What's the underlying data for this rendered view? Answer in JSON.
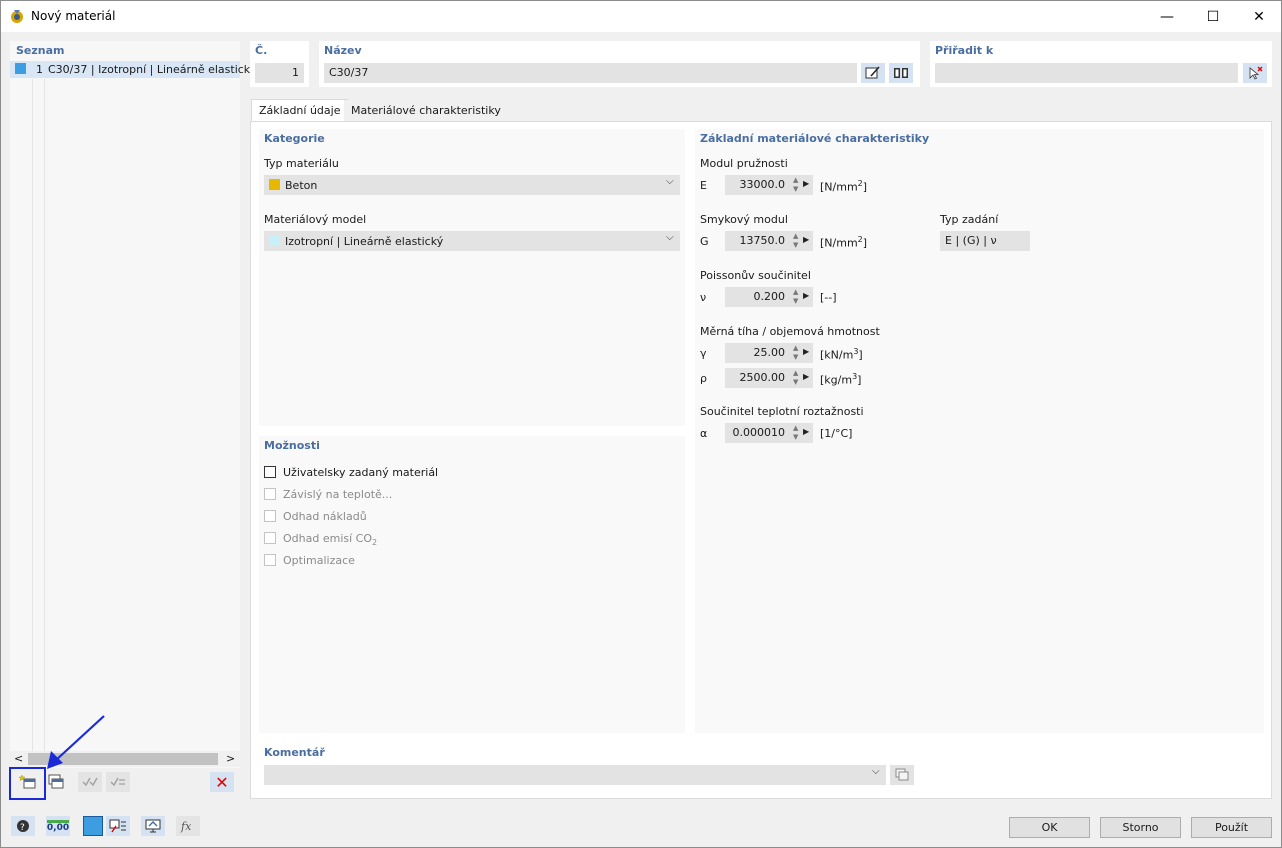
{
  "window": {
    "title": "Nový materiál",
    "minimize_label": "—",
    "maximize_label": "☐",
    "close_label": "✕"
  },
  "left": {
    "title": "Seznam",
    "items": [
      {
        "no": "1",
        "label": "C30/37 | Izotropní | Lineárně elastický"
      }
    ],
    "scroll_left": "<",
    "scroll_right": ">",
    "delete_label": "✕"
  },
  "header": {
    "no_title": "Č.",
    "no_value": "1",
    "name_title": "Název",
    "name_value": "C30/37",
    "assign_title": "Přiřadit k",
    "assign_value": ""
  },
  "tabs": [
    {
      "label": "Základní údaje",
      "active": true
    },
    {
      "label": "Materiálové charakteristiky",
      "active": false
    }
  ],
  "category": {
    "title": "Kategorie",
    "type_label": "Typ materiálu",
    "type_value": "Beton",
    "type_color": "#e6b800",
    "model_label": "Materiálový model",
    "model_value": "Izotropní | Lineárně elastický",
    "model_color": "#c8f0f8",
    "dropdown_arrow": "⌵"
  },
  "options": {
    "title": "Možnosti",
    "items": [
      {
        "label": "Uživatelsky zadaný materiál",
        "checked": false,
        "enabled": true
      },
      {
        "label": "Závislý na teplotě...",
        "checked": false,
        "enabled": false
      },
      {
        "label": "Odhad nákladů",
        "checked": false,
        "enabled": false
      },
      {
        "label": "Odhad emisí CO",
        "sub": "2",
        "checked": false,
        "enabled": false
      },
      {
        "label": "Optimalizace",
        "checked": false,
        "enabled": false
      }
    ]
  },
  "props": {
    "title": "Základní materiálové charakteristiky",
    "modulus_label": "Modul pružnosti",
    "E_sym": "E",
    "E_value": "33000.0",
    "E_unit": "[N/mm",
    "E_unit_sup": "2",
    "E_unit_end": "]",
    "shear_label": "Smykový modul",
    "G_sym": "G",
    "G_value": "13750.0",
    "G_unit": "[N/mm",
    "G_unit_sup": "2",
    "G_unit_end": "]",
    "input_type_label": "Typ zadání",
    "input_type_value": "E | (G) | ν",
    "poisson_label": "Poissonův součinitel",
    "nu_sym": "ν",
    "nu_value": "0.200",
    "nu_unit": "[--]",
    "weight_label": "Měrná tíha / objemová hmotnost",
    "gamma_sym": "γ",
    "gamma_value": "25.00",
    "gamma_unit": "[kN/m",
    "gamma_unit_sup": "3",
    "gamma_unit_end": "]",
    "rho_sym": "ρ",
    "rho_value": "2500.00",
    "rho_unit": "[kg/m",
    "rho_unit_sup": "3",
    "rho_unit_end": "]",
    "thermal_label": "Součinitel teplotní roztažnosti",
    "alpha_sym": "α",
    "alpha_value": "0.000010",
    "alpha_unit": "[1/°C]"
  },
  "comment": {
    "title": "Komentář",
    "value": ""
  },
  "footer": {
    "ok": "OK",
    "cancel": "Storno",
    "apply": "Použít"
  },
  "bottom_icons": {
    "zero_label": "0,00"
  }
}
